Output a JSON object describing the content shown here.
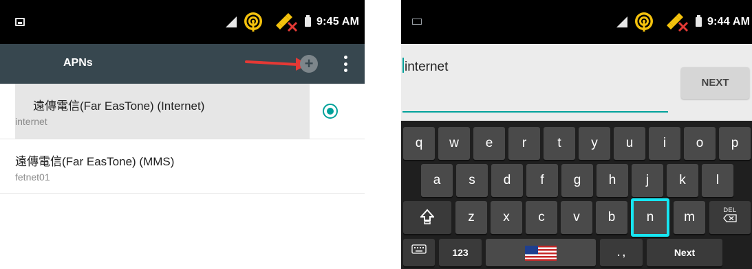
{
  "left": {
    "status_time": "9:45 AM",
    "toolbar_title": "APNs",
    "apns": [
      {
        "name": "遠傳電信(Far EasTone) (Internet)",
        "apn": "internet",
        "selected": true
      },
      {
        "name": "遠傳電信(Far EasTone) (MMS)",
        "apn": "fetnet01",
        "selected": false
      }
    ],
    "icons": [
      "image-notification-icon",
      "signal-icon",
      "hotspot-icon",
      "gps-icon",
      "battery-icon",
      "red-arrow-icon",
      "add-icon",
      "overflow-menu-icon"
    ]
  },
  "right": {
    "status_time": "9:44 AM",
    "input_value": "internet",
    "next_button": "NEXT",
    "keyboard": {
      "row1": [
        "q",
        "w",
        "e",
        "r",
        "t",
        "y",
        "u",
        "i",
        "o",
        "p"
      ],
      "row2": [
        "a",
        "s",
        "d",
        "f",
        "g",
        "h",
        "j",
        "k",
        "l"
      ],
      "row3": [
        "z",
        "x",
        "c",
        "v",
        "b",
        "n",
        "m"
      ],
      "del_label": "DEL",
      "numbers_key": "123",
      "punct_key": ". ,",
      "action_key": "Next",
      "highlighted_key": "n"
    },
    "icons": [
      "sim-notification-icon",
      "signal-icon",
      "hotspot-icon",
      "gps-icon",
      "battery-icon",
      "shift-icon",
      "backspace-icon",
      "keyboard-settings-icon",
      "us-flag-icon"
    ]
  },
  "colors": {
    "statusbar": "#000000",
    "toolbar": "#37474f",
    "accent": "#00a19a",
    "highlight": "#17e6f2",
    "arrow": "#e53935",
    "keyboard_bg": "#1f1f1f",
    "key": "#4a4a4a"
  }
}
